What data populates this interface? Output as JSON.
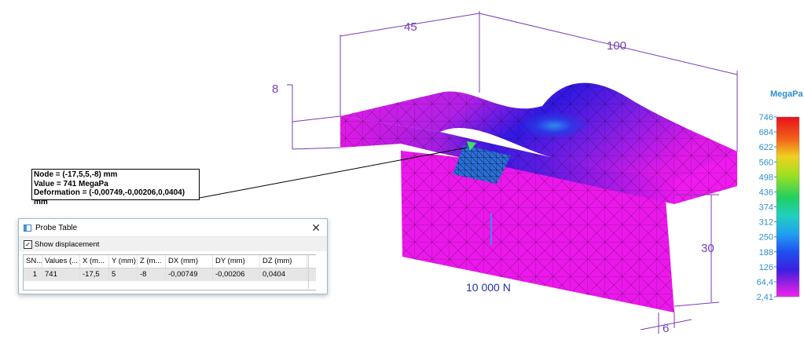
{
  "probe_table": {
    "title": "Probe Table",
    "close_label": "✕",
    "show_displacement_label": "Show displacement",
    "show_displacement_checked": true,
    "columns": [
      "SN...",
      "Values (...",
      "X (m...",
      "Y (mm)",
      "Z (m...",
      "DX (mm)",
      "DY (mm)",
      "DZ (mm)"
    ],
    "rows": [
      [
        "1",
        "741",
        "-17,5",
        "5",
        "-8",
        "-0,00749",
        "-0,00206",
        "0,0404"
      ]
    ]
  },
  "node_callout": {
    "line1": "Node = (-17,5,5,-8) mm",
    "line2": "Value = 741 MegaPa",
    "line3": "Deformation = (-0,00749,-0,00206,0,0404) mm"
  },
  "dimensions": {
    "d45": "45",
    "d100": "100",
    "d8": "8",
    "d30": "30",
    "d6": "6"
  },
  "load_label": "10 000 N",
  "legend": {
    "unit": "MegaPa",
    "ticks": [
      "746",
      "684",
      "622",
      "560",
      "498",
      "436",
      "374",
      "312",
      "250",
      "188",
      "126",
      "64,4",
      "2,41"
    ]
  },
  "colors": {
    "dimension": "#7a3cb8",
    "load": "#1f2fb0",
    "legend_text": "#2f8fd0",
    "mesh_magenta": "#ee16ee",
    "mesh_blue": "#3a1be0"
  }
}
